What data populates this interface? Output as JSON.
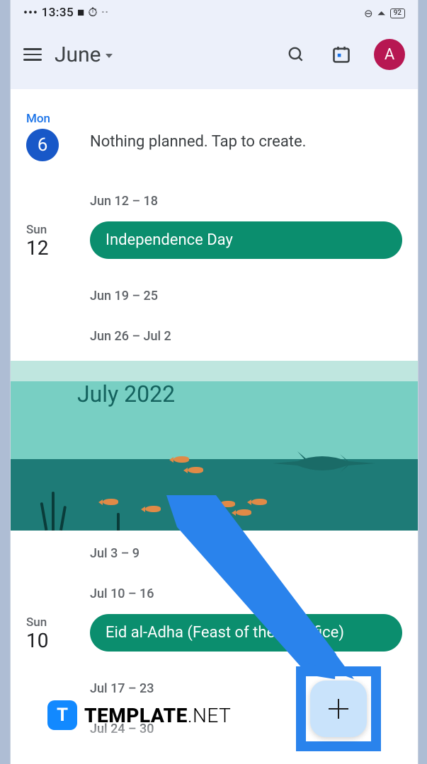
{
  "status": {
    "time": "13:35"
  },
  "header": {
    "month_label": "June",
    "avatar_initial": "A"
  },
  "today": {
    "dow": "Mon",
    "date": "6",
    "empty_text": "Nothing planned. Tap to create."
  },
  "ranges": {
    "r1": "Jun 12 – 18",
    "r2": "Jun 19 – 25",
    "r3": "Jun 26 – Jul 2",
    "r4": "Jul 3 – 9",
    "r5": "Jul 10 – 16",
    "r6": "Jul 17 – 23",
    "r7": "Jul 24 – 30"
  },
  "events": {
    "independence": {
      "dow": "Sun",
      "date": "12",
      "title": "Independence Day"
    },
    "eid": {
      "dow": "Sun",
      "date": "10",
      "title": "Eid al-Adha (Feast of the Sacrifice)"
    }
  },
  "month_hero": {
    "title": "July 2022"
  },
  "watermark": {
    "bold": "TEMPLATE",
    "light": ".NET",
    "badge": "T"
  }
}
